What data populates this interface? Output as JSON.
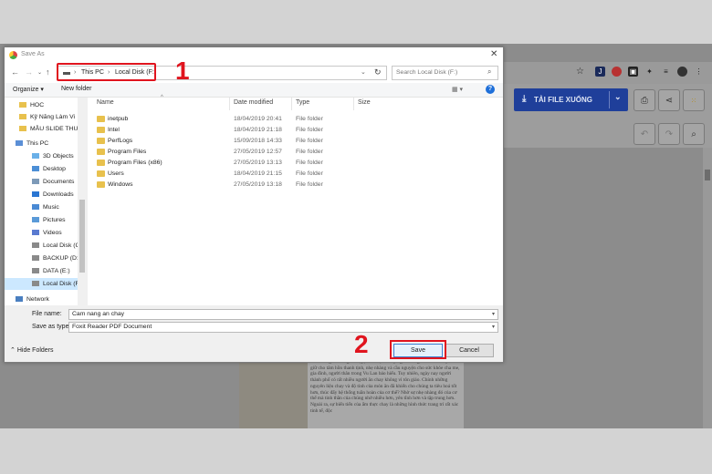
{
  "dialog": {
    "title": "Save As",
    "breadcrumb": [
      "This PC",
      "Local Disk (F:)"
    ],
    "search_placeholder": "Search Local Disk (F:)",
    "organize": "Organize",
    "new_folder": "New folder",
    "columns": {
      "name": "Name",
      "date": "Date modified",
      "type": "Type",
      "size": "Size"
    },
    "sidebar": [
      {
        "label": "HOC",
        "icon": "folder-icon"
      },
      {
        "label": "Kỹ Năng Làm Vi",
        "icon": "folder-icon"
      },
      {
        "label": "MẪU SLIDE THU",
        "icon": "folder-icon"
      },
      {
        "label": "This PC",
        "icon": "computer-icon"
      },
      {
        "label": "3D Objects",
        "icon": "cube-icon"
      },
      {
        "label": "Desktop",
        "icon": "desktop-icon"
      },
      {
        "label": "Documents",
        "icon": "documents-icon"
      },
      {
        "label": "Downloads",
        "icon": "download-icon"
      },
      {
        "label": "Music",
        "icon": "music-icon"
      },
      {
        "label": "Pictures",
        "icon": "pictures-icon"
      },
      {
        "label": "Videos",
        "icon": "videos-icon"
      },
      {
        "label": "Local Disk (C:)",
        "icon": "drive-icon"
      },
      {
        "label": "BACKUP (D:)",
        "icon": "drive-icon"
      },
      {
        "label": "DATA (E:)",
        "icon": "drive-icon"
      },
      {
        "label": "Local Disk (F:)",
        "icon": "drive-icon",
        "selected": true
      },
      {
        "label": "Network",
        "icon": "network-icon"
      }
    ],
    "files": [
      {
        "name": "inetpub",
        "date": "18/04/2019 20:41",
        "type": "File folder"
      },
      {
        "name": "Intel",
        "date": "18/04/2019 21:18",
        "type": "File folder"
      },
      {
        "name": "PerfLogs",
        "date": "15/09/2018 14:33",
        "type": "File folder"
      },
      {
        "name": "Program Files",
        "date": "27/05/2019 12:57",
        "type": "File folder"
      },
      {
        "name": "Program Files (x86)",
        "date": "27/05/2019 13:13",
        "type": "File folder"
      },
      {
        "name": "Users",
        "date": "18/04/2019 21:15",
        "type": "File folder"
      },
      {
        "name": "Windows",
        "date": "27/05/2019 13:18",
        "type": "File folder"
      }
    ],
    "file_name_label": "File name:",
    "file_name_value": "Cam nang an chay",
    "save_type_label": "Save as type:",
    "save_type_value": "Foxit Reader PDF Document",
    "hide_folders": "Hide Folders",
    "save": "Save",
    "cancel": "Cancel"
  },
  "annotations": {
    "step1": "1",
    "step2": "2",
    "color": "#e0141e"
  },
  "foxit": {
    "download_label": "TẢI FILE XUỐNG",
    "accent": "#1f3f9a"
  },
  "pdf_text": "đến những lo lường tốt đẹp, nhân đạo.\nVề ý nghĩa tôn giáo thì ăn chay là để giữ cho tâm hồn thanh tịnh, nhẹ nhàng và cầu nguyện cho sức khỏe cha me, gia đình, người thân trong Vu Lan báo hiếu. Tuy nhiên, ngày nay người thành phố có rất nhiều người ăn chay không vì tôn giáo. Chính những nguyên liệu chay và độ tinh của món ăn đã khiến cho chúng ta tiêu hoá tốt hơn, thúc đẩy hệ thống tuần hoàn của cơ thể? Nhờ sự nhẹ nhàng đó của cơ thể mà tinh thần của chúng nhờ nhiều hơn, yên tĩnh hơn và tập trung hơn. Ngoài ra, sự biến tiến của ẩm thực chay là những hình thức trang trí rất xác tinh tế, độc"
}
